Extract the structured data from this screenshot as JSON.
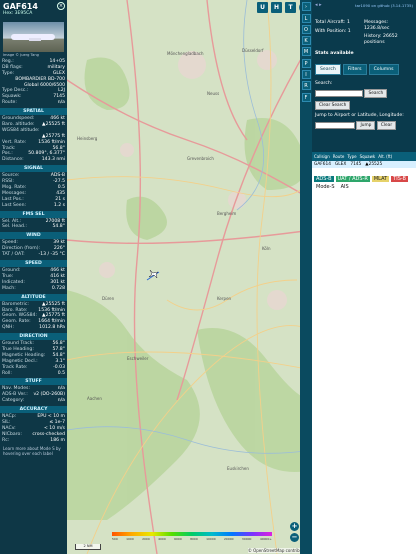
{
  "aircraft": {
    "callsign": "GAF614",
    "hex_label": "Hex: 3E95CA",
    "photo_caption": "Image © Juerg Tang",
    "close": "×"
  },
  "details": [
    {
      "k": "Reg.:",
      "v": "14+05"
    },
    {
      "k": "DB flags:",
      "v": "military"
    },
    {
      "k": "Type:",
      "v": "GLEX"
    },
    {
      "k": "",
      "v": "BOMBARDIER BD-700"
    },
    {
      "k": "",
      "v": "Global 6000/6500"
    },
    {
      "k": "Type Desc.:",
      "v": "L2J"
    },
    {
      "k": "Squawk:",
      "v": "7145"
    },
    {
      "k": "Route:",
      "v": "n/a"
    }
  ],
  "sections": {
    "spatial": "SPATIAL",
    "signal": "SIGNAL",
    "fms": "FMS SEL",
    "wind": "WIND",
    "speed": "SPEED",
    "altitude": "ALTITUDE",
    "direction": "DIRECTION",
    "stuff": "STUFF",
    "accuracy": "ACCURACY"
  },
  "spatial": [
    {
      "k": "Groundspeed:",
      "v": "466 kt"
    },
    {
      "k": "Baro. altitude:",
      "v": "▲25525 ft"
    },
    {
      "k": "WGS84 altitude:",
      "v": ""
    },
    {
      "k": "",
      "v": "▲25775 ft"
    },
    {
      "k": "Vert. Rate:",
      "v": "1536 ft/min"
    },
    {
      "k": "Track:",
      "v": "56.8°"
    },
    {
      "k": "Pos.:",
      "v": "50.809°, 6.377°"
    },
    {
      "k": "Distance:",
      "v": "143.3 nmi"
    }
  ],
  "signal": [
    {
      "k": "Source:",
      "v": "ADS-B"
    },
    {
      "k": "RSSI:",
      "v": "-27.5"
    },
    {
      "k": "Msg. Rate:",
      "v": "0.5"
    },
    {
      "k": "Messages:",
      "v": "435"
    },
    {
      "k": "Last Pos.:",
      "v": "21 s"
    },
    {
      "k": "Last Seen:",
      "v": "1.2 s"
    }
  ],
  "fms": [
    {
      "k": "Sel. Alt.:",
      "v": "27008 ft"
    },
    {
      "k": "Sel. Head.:",
      "v": "54.8°"
    }
  ],
  "wind": [
    {
      "k": "Speed:",
      "v": "39 kt"
    },
    {
      "k": "Direction (from):",
      "v": "226°"
    },
    {
      "k": "TAT / OAT:",
      "v": "-13 / -35 °C"
    }
  ],
  "speed": [
    {
      "k": "Ground:",
      "v": "466 kt"
    },
    {
      "k": "True:",
      "v": "416 kt"
    },
    {
      "k": "Indicated:",
      "v": "301 kt"
    },
    {
      "k": "Mach:",
      "v": "0.728"
    }
  ],
  "altitude": [
    {
      "k": "Barometric:",
      "v": "▲25525 ft"
    },
    {
      "k": "Baro. Rate:",
      "v": "1536 ft/min"
    },
    {
      "k": "Geom. WGS84:",
      "v": "▲25775 ft"
    },
    {
      "k": "Geom. Rate:",
      "v": "1664 ft/min"
    },
    {
      "k": "QNH:",
      "v": "1012.8 hPa"
    }
  ],
  "direction": [
    {
      "k": "Ground Track:",
      "v": "56.8°"
    },
    {
      "k": "True Heading:",
      "v": "57.8°"
    },
    {
      "k": "Magnetic Heading:",
      "v": "54.8°"
    },
    {
      "k": "Magnetic Decl.:",
      "v": "3.1°"
    },
    {
      "k": "Track Rate:",
      "v": "-0.03"
    },
    {
      "k": "Roll:",
      "v": "0.5"
    }
  ],
  "stuff": [
    {
      "k": "Nav. Modes:",
      "v": "n/a"
    },
    {
      "k": "ADS-B Ver.:",
      "v": "v2 (DO-260B)"
    },
    {
      "k": "Category:",
      "v": "n/a"
    }
  ],
  "accuracy": [
    {
      "k": "NACp:",
      "v": "EPU < 10 m"
    },
    {
      "k": "SIL:",
      "v": "≤ 1e-7"
    },
    {
      "k": "NACv:",
      "v": "< 10 m/s"
    },
    {
      "k": "NICbaro:",
      "v": "cross-checked"
    },
    {
      "k": "Rc:",
      "v": "186 m"
    }
  ],
  "learn_more": "Learn more about Mode S by hovering over each label",
  "map": {
    "buttons": [
      "U",
      "H",
      "T"
    ],
    "places": [
      "Mönchengladbach",
      "Düsseldorf",
      "Neuss",
      "Grevenbroich",
      "Heinsberg",
      "Bergheim",
      "Köln",
      "Düren",
      "Aachen",
      "Eschweiler",
      "Kerpen",
      "Euskirchen"
    ],
    "altitudes": [
      "500",
      "1000",
      "2000",
      "4000",
      "6000",
      "8000",
      "10000",
      "20000",
      "30000",
      "40000+"
    ],
    "scale": "2 NM",
    "attribution": "© OpenStreetMap contributors",
    "zoom_in": "+",
    "zoom_out": "−"
  },
  "toolbar": [
    "L",
    "O",
    "K",
    "M",
    "P",
    "I",
    "R",
    "F"
  ],
  "right": {
    "nav": "◂ ▸",
    "version_link": "tar1090 on github (3.14.1735)",
    "total_aircraft": "Total Aircraft: 1",
    "with_position": "With Position: 1",
    "messages": "Messages: 1236.8/sec",
    "history": "History: 26652 positions",
    "stats_available": "Stats available",
    "tabs": [
      "Search",
      "Filters",
      "Columns"
    ],
    "search_label": "Search:",
    "search_btn": "Search",
    "clear_btn": "Clear Search",
    "jump_label": "Jump to Airport or Latitude, Longitude:",
    "jump_btn": "Jump",
    "clear2_btn": "Clear",
    "columns": [
      "Callsign",
      "Route",
      "Type",
      "Squawk",
      "Alt. (ft)"
    ],
    "row": [
      "GAF614",
      "GLEX",
      "7145",
      "▲25525"
    ],
    "tags": [
      "ADS-B",
      "UAT / ADS-R",
      "MLAT",
      "TIS-B",
      "Mode-S",
      "AIS"
    ]
  }
}
